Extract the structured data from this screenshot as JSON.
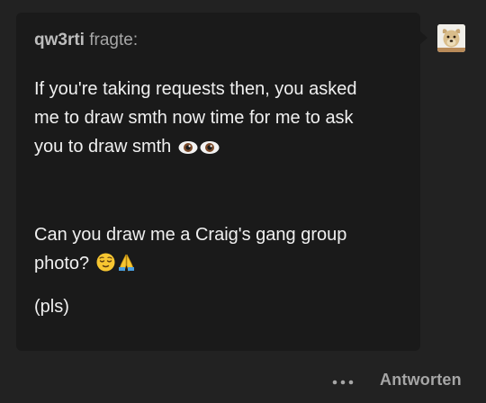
{
  "ask": {
    "asker_name": "qw3rti",
    "asked_label": "fragte:",
    "message": {
      "line_1": "If you're taking requests then, you asked",
      "line_2": "me to draw smth now time for me to ask",
      "line_3": "you to draw smth",
      "line_4": "Can you draw me a Craig's gang group",
      "line_5": "photo?",
      "line_6": "(pls)"
    },
    "emojis": {
      "paragraph_1": [
        "eye-icon",
        "eye-icon"
      ],
      "paragraph_2": [
        "relieved-face-icon",
        "folded-hands-icon"
      ]
    }
  },
  "avatar": {
    "icon": "dog-avatar-icon"
  },
  "footer": {
    "more_icon": "ellipsis-icon",
    "reply_label": "Antworten"
  },
  "colors": {
    "page_background": "#222222",
    "card_background": "#1a1a1a",
    "body_text": "#f0f0f0",
    "muted_text": "#a6a6a6"
  }
}
